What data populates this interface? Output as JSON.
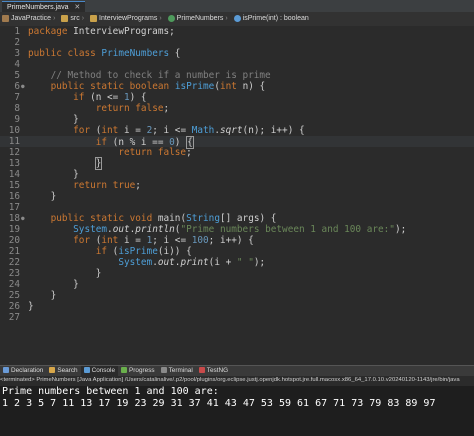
{
  "editor_tab": {
    "label": "PrimeNumbers.java",
    "close": "✕"
  },
  "breadcrumb": [
    {
      "label": "JavaPractice",
      "icon": "project-icon",
      "color": "#a07a4e"
    },
    {
      "label": "src",
      "icon": "source-folder-icon",
      "color": "#c9a14a"
    },
    {
      "label": "InterviewPrograms",
      "icon": "package-icon",
      "color": "#c9a14a"
    },
    {
      "label": "PrimeNumbers",
      "icon": "class-icon",
      "color": "#4e9a5c"
    },
    {
      "label": "isPrime(int) : boolean",
      "icon": "method-icon",
      "color": "#5b9bd5"
    }
  ],
  "colors": {
    "background": "#2b2b2b",
    "keyword": "#cc7832",
    "type": "#4e9fd8",
    "string": "#6a8759",
    "comment": "#808080",
    "console_bg": "#1e1e1e"
  },
  "code_lines": [
    {
      "n": "1",
      "text": "package InterviewPrograms;"
    },
    {
      "n": "2",
      "text": ""
    },
    {
      "n": "3",
      "text": "public class PrimeNumbers {"
    },
    {
      "n": "4",
      "text": ""
    },
    {
      "n": "5",
      "text": "    // Method to check if a number is prime"
    },
    {
      "n": "6",
      "text": "    public static boolean isPrime(int n) {"
    },
    {
      "n": "7",
      "text": "        if (n <= 1) {"
    },
    {
      "n": "8",
      "text": "            return false;"
    },
    {
      "n": "9",
      "text": "        }"
    },
    {
      "n": "10",
      "text": "        for (int i = 2; i <= Math.sqrt(n); i++) {"
    },
    {
      "n": "11",
      "text": "            if (n % i == 0) {"
    },
    {
      "n": "12",
      "text": "                return false;"
    },
    {
      "n": "13",
      "text": "            }"
    },
    {
      "n": "14",
      "text": "        }"
    },
    {
      "n": "15",
      "text": "        return true;"
    },
    {
      "n": "16",
      "text": "    }"
    },
    {
      "n": "17",
      "text": ""
    },
    {
      "n": "18",
      "text": "    public static void main(String[] args) {"
    },
    {
      "n": "19",
      "text": "        System.out.println(\"Prime numbers between 1 and 100 are:\");"
    },
    {
      "n": "20",
      "text": "        for (int i = 1; i <= 100; i++) {"
    },
    {
      "n": "21",
      "text": "            if (isPrime(i)) {"
    },
    {
      "n": "22",
      "text": "                System.out.print(i + \" \");"
    },
    {
      "n": "23",
      "text": "            }"
    },
    {
      "n": "24",
      "text": "        }"
    },
    {
      "n": "25",
      "text": "    }"
    },
    {
      "n": "26",
      "text": "}"
    },
    {
      "n": "27",
      "text": ""
    }
  ],
  "panel_tabs": [
    {
      "label": "Declaration",
      "icon": "declaration-icon",
      "color": "#6a9bd8"
    },
    {
      "label": "Search",
      "icon": "search-icon",
      "color": "#d8a74a"
    },
    {
      "label": "Console",
      "icon": "console-icon",
      "color": "#5b9bd5",
      "active": true
    },
    {
      "label": "Progress",
      "icon": "progress-icon",
      "color": "#6ab04c"
    },
    {
      "label": "Terminal",
      "icon": "terminal-icon",
      "color": "#8a8a8a"
    },
    {
      "label": "TestNG",
      "icon": "testng-icon",
      "color": "#c94a4a"
    }
  ],
  "console_header": "<terminated> PrimeNumbers [Java Application] /Users/catalinalive/.p2/pool/plugins/org.eclipse.justj.openjdk.hotspot.jre.full.macosx.x86_64_17.0.10.v20240120-1143/jre/bin/java",
  "console_output": [
    "Prime numbers between 1 and 100 are:",
    "1 2 3 5 7 11 13 17 19 23 29 31 37 41 43 47 53 59 61 67 71 73 79 83 89 97"
  ]
}
